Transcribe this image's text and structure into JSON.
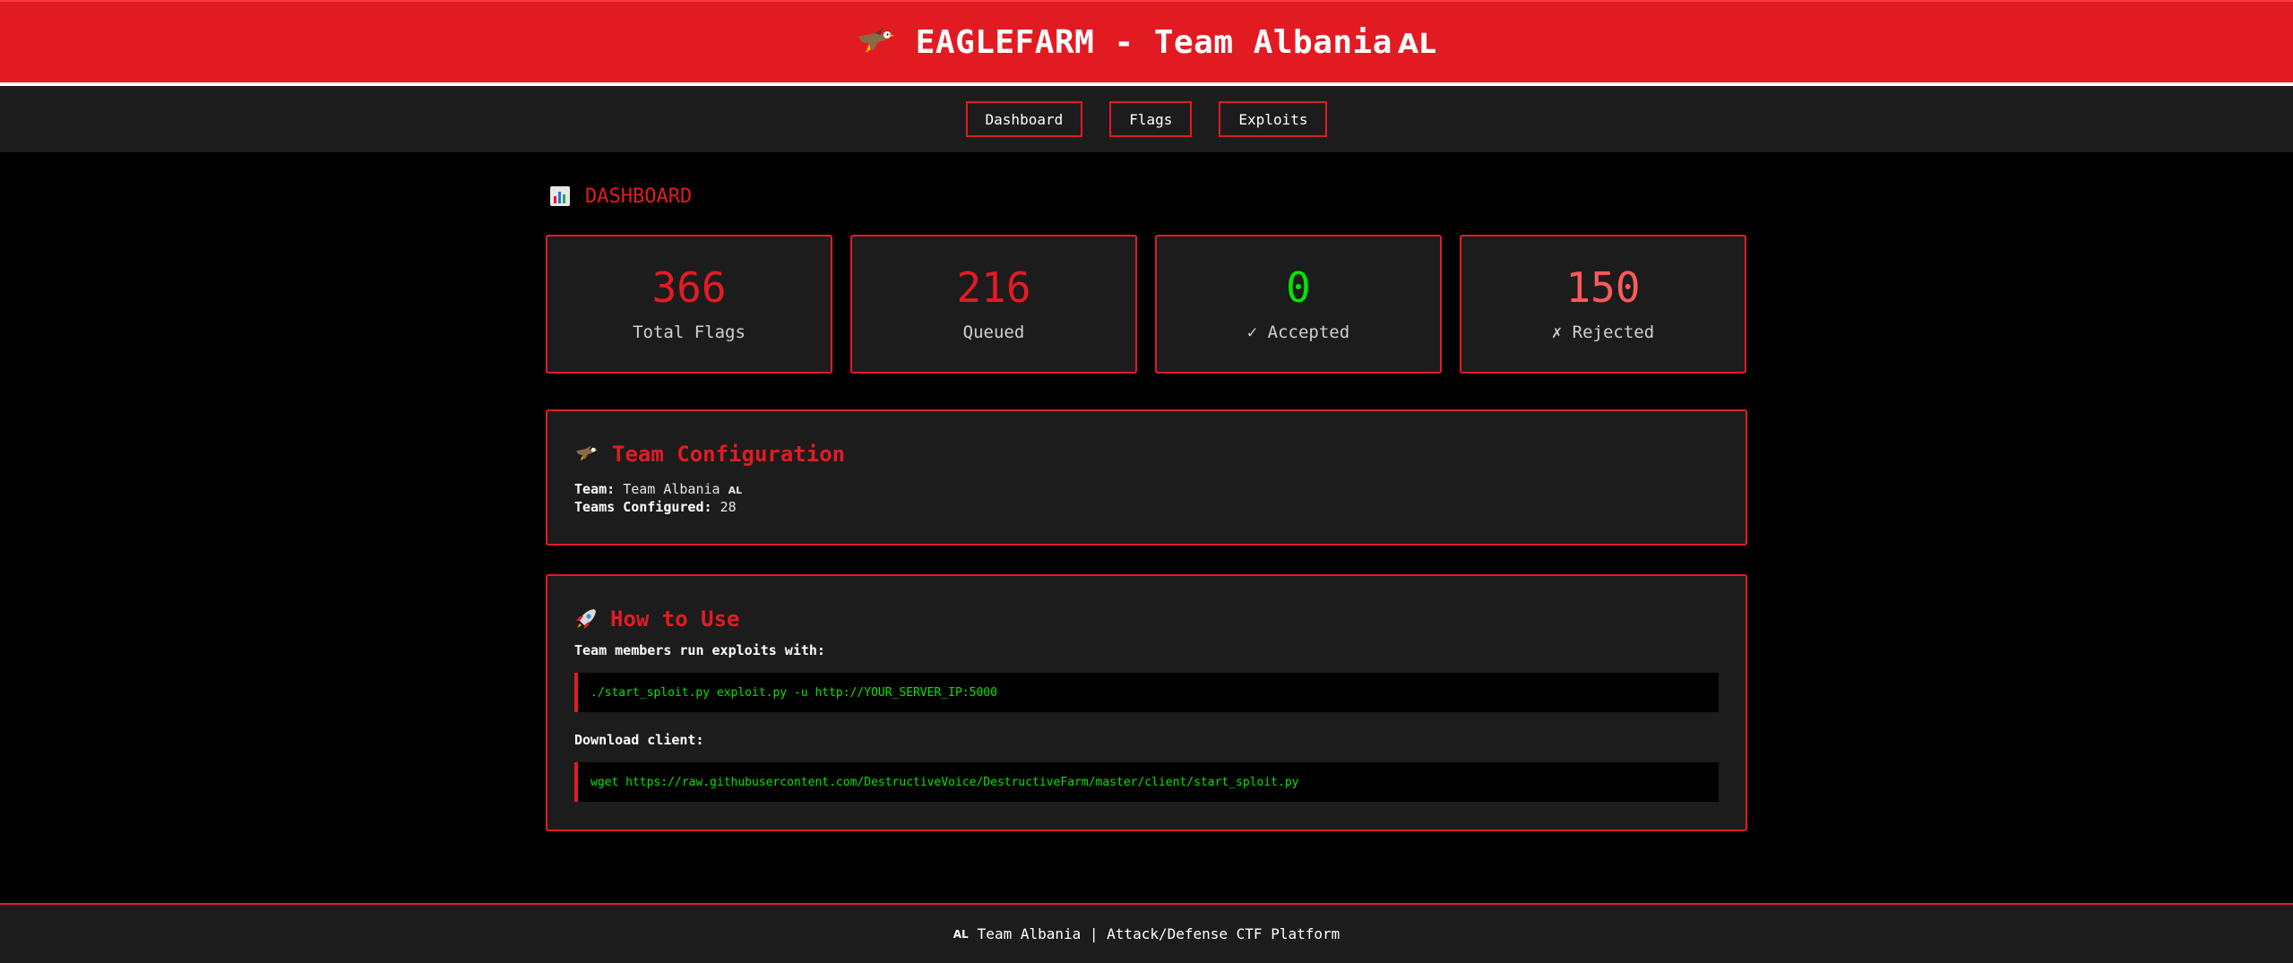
{
  "header": {
    "title": "EAGLEFARM - Team Albania",
    "country_code": "AL",
    "icon": "eagle-icon"
  },
  "nav": {
    "items": [
      {
        "label": "Dashboard"
      },
      {
        "label": "Flags"
      },
      {
        "label": "Exploits"
      }
    ]
  },
  "dashboard": {
    "title": "DASHBOARD",
    "icon": "bar-chart-icon",
    "stats": [
      {
        "value": "366",
        "label": "Total Flags",
        "color": "#e21b23"
      },
      {
        "value": "216",
        "label": "Queued",
        "color": "#e21b23"
      },
      {
        "value": "0",
        "label": "✓ Accepted",
        "color": "#00e600"
      },
      {
        "value": "150",
        "label": "✗ Rejected",
        "color": "#ff5a5a"
      }
    ]
  },
  "team_config": {
    "title": "Team Configuration",
    "icon": "eagle-icon",
    "team_key": "Team:",
    "team_value": "Team Albania",
    "team_code": "AL",
    "configured_key": "Teams Configured:",
    "configured_value": "28"
  },
  "how_to": {
    "title": "How to Use",
    "icon": "rocket-icon",
    "step1_label": "Team members run exploits with:",
    "step1_code": "./start_sploit.py exploit.py -u http://YOUR_SERVER_IP:5000",
    "step2_label": "Download client:",
    "step2_code": "wget https://raw.githubusercontent.com/DestructiveVoice/DestructiveFarm/master/client/start_sploit.py"
  },
  "footer": {
    "code": "AL",
    "text": "Team Albania | Attack/Defense CTF Platform"
  },
  "colors": {
    "accent": "#e21b23",
    "success": "#00e600",
    "panel": "#1c1c1c",
    "background": "#000000"
  }
}
